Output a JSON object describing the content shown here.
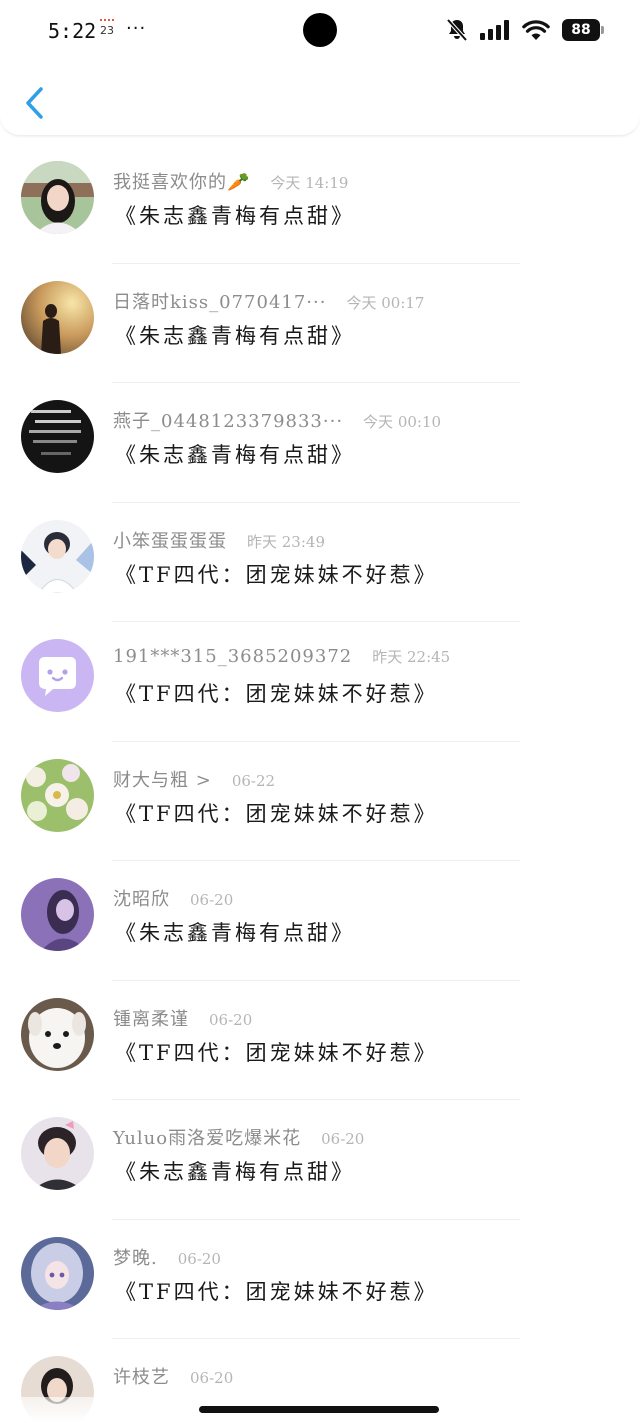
{
  "status_bar": {
    "time": "5:22",
    "calendar_day": "23",
    "more": "···",
    "battery": "88"
  },
  "colors": {
    "accent": "#2f9fe8",
    "name_text": "#8c8c8c",
    "time_text": "#b5b5b5",
    "message_text": "#1a1a1a",
    "divider": "#efefef"
  },
  "header": {
    "back_icon": "chevron-left-icon"
  },
  "rows": [
    {
      "name": "我挺喜欢你的🥕",
      "time": "今天 14:19",
      "message": "《朱志鑫青梅有点甜》",
      "avatar": "girl-portrait"
    },
    {
      "name": "日落时kiss_0770417···",
      "time": "今天 00:17",
      "message": "《朱志鑫青梅有点甜》",
      "avatar": "sunset-silhouette"
    },
    {
      "name": "燕子_0448123379833···",
      "time": "今天 00:10",
      "message": "《朱志鑫青梅有点甜》",
      "avatar": "dark-text-image"
    },
    {
      "name": "小笨蛋蛋蛋蛋",
      "time": "昨天 23:49",
      "message": "《TF四代：团宠妹妹不好惹》",
      "avatar": "boy-sticker"
    },
    {
      "name": "191***315_3685209372",
      "time": "昨天 22:45",
      "message": "《TF四代：团宠妹妹不好惹》",
      "avatar": "default-chat-avatar"
    },
    {
      "name": "财大与粗 >",
      "time": "06-22",
      "message": "《TF四代：团宠妹妹不好惹》",
      "avatar": "flower-collage"
    },
    {
      "name": "沈昭欣",
      "time": "06-20",
      "message": "《朱志鑫青梅有点甜》",
      "avatar": "purple-girl"
    },
    {
      "name": "锺离柔谨",
      "time": "06-20",
      "message": "《TF四代：团宠妹妹不好惹》",
      "avatar": "white-dog"
    },
    {
      "name": "Yuluo雨洛爱吃爆米花",
      "time": "06-20",
      "message": "《朱志鑫青梅有点甜》",
      "avatar": "boy-pink-bow"
    },
    {
      "name": "梦晚.",
      "time": "06-20",
      "message": "《TF四代：团宠妹妹不好惹》",
      "avatar": "anime-girl"
    },
    {
      "name": "许枝艺",
      "time": "06-20",
      "message": "",
      "avatar": "girl-partial"
    }
  ]
}
